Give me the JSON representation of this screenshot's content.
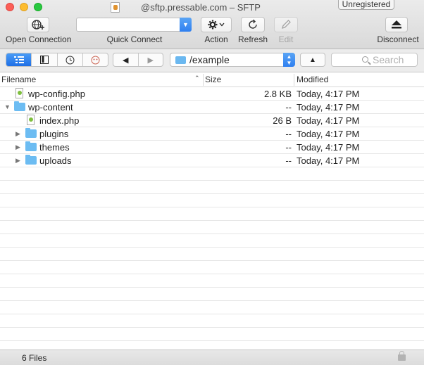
{
  "window": {
    "title": "@sftp.pressable.com – SFTP",
    "badge": "Unregistered"
  },
  "toolbar": {
    "open_connection": "Open Connection",
    "quick_connect": "Quick Connect",
    "action": "Action",
    "refresh": "Refresh",
    "edit": "Edit",
    "disconnect": "Disconnect"
  },
  "navbar": {
    "path": "/example",
    "search_placeholder": "Search"
  },
  "columns": {
    "filename": "Filename",
    "size": "Size",
    "modified": "Modified"
  },
  "files": [
    {
      "name": "wp-config.php",
      "size": "2.8 KB",
      "modified": "Today, 4:17 PM",
      "kind": "php",
      "depth": 0,
      "expanded": null
    },
    {
      "name": "wp-content",
      "size": "--",
      "modified": "Today, 4:17 PM",
      "kind": "folder",
      "depth": 0,
      "expanded": true
    },
    {
      "name": "index.php",
      "size": "26 B",
      "modified": "Today, 4:17 PM",
      "kind": "php",
      "depth": 1,
      "expanded": null
    },
    {
      "name": "plugins",
      "size": "--",
      "modified": "Today, 4:17 PM",
      "kind": "folder",
      "depth": 1,
      "expanded": false
    },
    {
      "name": "themes",
      "size": "--",
      "modified": "Today, 4:17 PM",
      "kind": "folder",
      "depth": 1,
      "expanded": false
    },
    {
      "name": "uploads",
      "size": "--",
      "modified": "Today, 4:17 PM",
      "kind": "folder",
      "depth": 1,
      "expanded": false
    }
  ],
  "status": {
    "count": "6 Files"
  },
  "colors": {
    "accent": "#2f7ff0",
    "folder": "#6cbcf2"
  }
}
